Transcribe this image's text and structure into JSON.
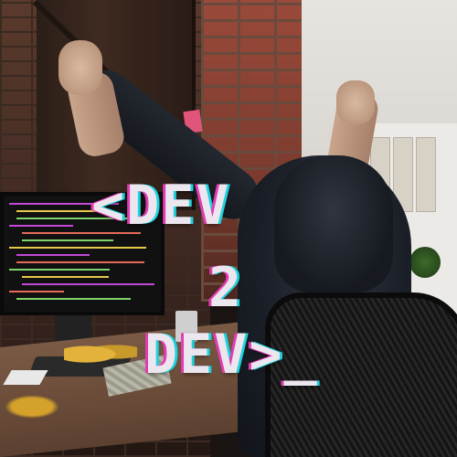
{
  "poster": {
    "title_line_1": "<DEV",
    "title_line_2": "2",
    "title_line_3": "DEV>_"
  },
  "colors": {
    "glitch_magenta": "#e23cb4",
    "glitch_cyan": "#20d2dc",
    "title_text": "#ece6ee"
  }
}
